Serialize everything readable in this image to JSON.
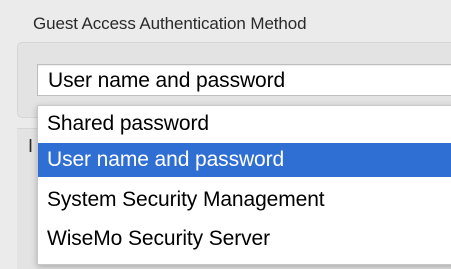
{
  "section": {
    "title": "Guest Access Authentication Method",
    "partial_label": "I"
  },
  "select": {
    "value": "User name and password"
  },
  "dropdown": {
    "options": [
      {
        "label": "Shared password",
        "selected": false
      },
      {
        "label": "User name and password",
        "selected": true
      },
      {
        "label": "System Security Management",
        "selected": false
      },
      {
        "label": "WiseMo Security Server",
        "selected": false
      }
    ],
    "highlight_color": "#2f6fd3"
  }
}
